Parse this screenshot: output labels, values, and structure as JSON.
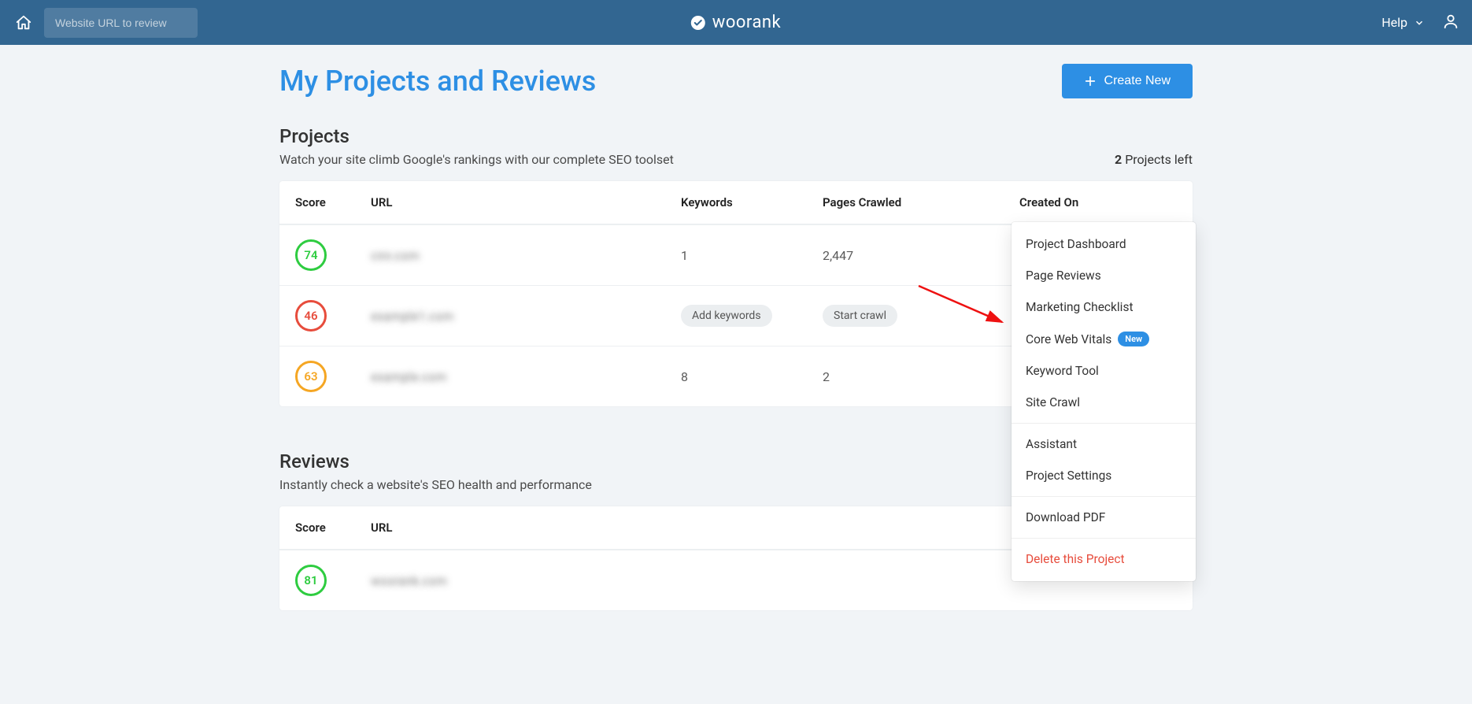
{
  "header": {
    "url_placeholder": "Website URL to review",
    "brand": "woorank",
    "help_label": "Help"
  },
  "page": {
    "title": "My Projects and Reviews",
    "create_label": "Create New"
  },
  "projects": {
    "title": "Projects",
    "subtitle": "Watch your site climb Google's rankings with our complete SEO toolset",
    "left_count": "2",
    "left_label": "Projects left",
    "columns": {
      "score": "Score",
      "url": "URL",
      "keywords": "Keywords",
      "pages": "Pages Crawled",
      "created": "Created On"
    },
    "rows": [
      {
        "score": "74",
        "score_class": "green",
        "url": "cnn.com",
        "keywords": "1",
        "pages": "2,447"
      },
      {
        "score": "46",
        "score_class": "red",
        "url": "example1.com",
        "keywords_action": "Add keywords",
        "pages_action": "Start crawl"
      },
      {
        "score": "63",
        "score_class": "yellow",
        "url": "example.com",
        "keywords": "8",
        "pages": "2"
      }
    ]
  },
  "reviews": {
    "title": "Reviews",
    "subtitle": "Instantly check a website's SEO health and performance",
    "columns": {
      "score": "Score",
      "url": "URL"
    },
    "rows": [
      {
        "score": "81",
        "score_class": "green",
        "url": "woorank.com"
      }
    ]
  },
  "dropdown": {
    "items": [
      {
        "label": "Project Dashboard"
      },
      {
        "label": "Page Reviews"
      },
      {
        "label": "Marketing Checklist"
      },
      {
        "label": "Core Web Vitals",
        "badge": "New"
      },
      {
        "label": "Keyword Tool"
      },
      {
        "label": "Site Crawl"
      }
    ],
    "items2": [
      {
        "label": "Assistant"
      },
      {
        "label": "Project Settings"
      }
    ],
    "items3": [
      {
        "label": "Download PDF"
      }
    ],
    "delete_label": "Delete this Project"
  }
}
